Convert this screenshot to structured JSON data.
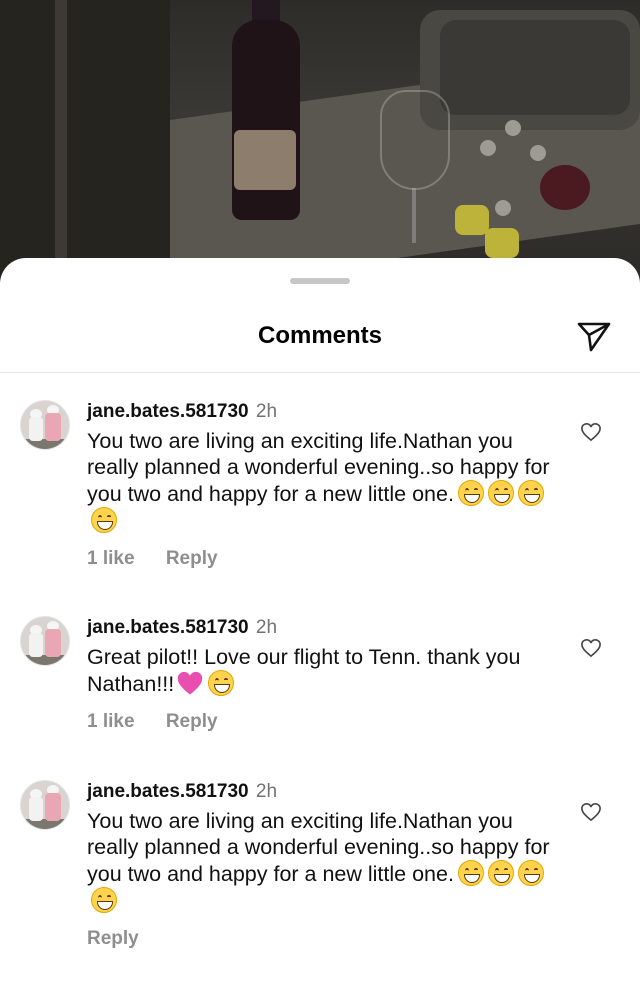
{
  "sheet": {
    "title": "Comments",
    "share_icon": "paper-plane-icon",
    "grabber_icon": "drag-handle"
  },
  "comments": [
    {
      "username": "jane.bates.581730",
      "time": "2h",
      "text": "You two are living an exciting life.Nathan you really planned a wonderful evening..so happy for you two and happy for a new little one.",
      "emojis": [
        "grinning-face",
        "grinning-face",
        "grinning-face",
        "grinning-face"
      ],
      "likes": "1 like",
      "reply": "Reply"
    },
    {
      "username": "jane.bates.581730",
      "time": "2h",
      "text": "Great pilot!! Love our flight to Tenn. thank you Nathan!!!",
      "emojis": [
        "pink-heart",
        "grinning-face"
      ],
      "likes": "1 like",
      "reply": "Reply"
    },
    {
      "username": "jane.bates.581730",
      "time": "2h",
      "text": "You two are living an exciting life.Nathan you really planned a wonderful evening..so happy for you two and happy for a new little one.",
      "emojis": [
        "grinning-face",
        "grinning-face",
        "grinning-face",
        "grinning-face"
      ],
      "likes": "",
      "reply": "Reply"
    }
  ],
  "colors": {
    "username": "#111111",
    "meta": "#8e8e8e",
    "pink_heart": "#e84fae",
    "emoji": "#ffd34d"
  }
}
